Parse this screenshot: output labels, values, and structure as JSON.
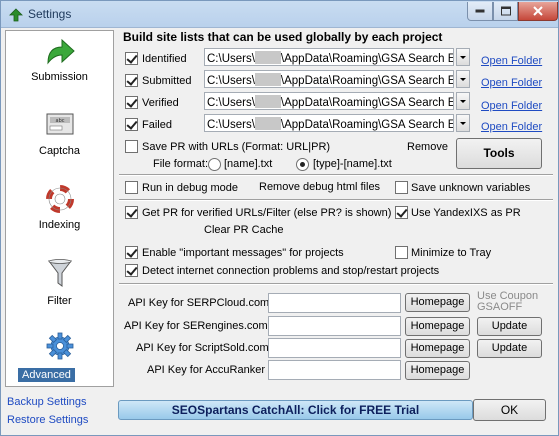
{
  "window": {
    "title": "Settings"
  },
  "sidebar": {
    "items": [
      {
        "label": "Submission",
        "icon": "green-arrow-icon"
      },
      {
        "label": "Captcha",
        "icon": "captcha-icon"
      },
      {
        "label": "Indexing",
        "icon": "lifebuoy-icon"
      },
      {
        "label": "Filter",
        "icon": "funnel-icon"
      },
      {
        "label": "Advanced",
        "icon": "gear-icon",
        "selected": true
      }
    ],
    "backup_label": "Backup Settings",
    "restore_label": "Restore Settings"
  },
  "site_lists": {
    "header": "Build site lists that can be used globally by each project",
    "rows": [
      {
        "label": "Identified",
        "checked": true,
        "path_prefix": "C:\\Users\\",
        "path_suffix": "\\AppData\\Roaming\\GSA Search Er",
        "link": "Open Folder"
      },
      {
        "label": "Submitted",
        "checked": true,
        "path_prefix": "C:\\Users\\",
        "path_suffix": "\\AppData\\Roaming\\GSA Search Er",
        "link": "Open Folder"
      },
      {
        "label": "Verified",
        "checked": true,
        "path_prefix": "C:\\Users\\",
        "path_suffix": "\\AppData\\Roaming\\GSA Search Er",
        "link": "Open Folder"
      },
      {
        "label": "Failed",
        "checked": true,
        "path_prefix": "C:\\Users\\",
        "path_suffix": "\\AppData\\Roaming\\GSA Search Er",
        "link": "Open Folder"
      }
    ],
    "save_pr_label": "Save PR with URLs (Format: URL|PR)",
    "remove_label": "Remove",
    "file_format_label": "File format:",
    "format_option_1": "[name].txt",
    "format_option_2": "[type]-[name].txt",
    "tools_label": "Tools"
  },
  "debug": {
    "run_debug_label": "Run in debug mode",
    "remove_debug_label": "Remove debug html files",
    "save_unknown_label": "Save unknown variables"
  },
  "pr": {
    "get_pr_label": "Get PR for verified URLs/Filter  (else PR? is shown)",
    "use_yandex_label": "Use YandexIXS as PR",
    "clear_pr_label": "Clear PR Cache"
  },
  "messages": {
    "important_label": "Enable \"important messages\" for projects",
    "minimize_label": "Minimize to Tray",
    "detect_label": "Detect internet connection problems and stop/restart projects"
  },
  "api": {
    "serpcloud_label": "API Key for SERPCloud.com",
    "serengines_label": "API Key for SERengines.com",
    "scriptsold_label": "API Key for ScriptSold.com",
    "accuranker_label": "API Key for AccuRanker",
    "homepage_label": "Homepage",
    "update_label": "Update",
    "coupon_line1": "Use Coupon",
    "coupon_line2": "GSAOFF"
  },
  "footer": {
    "catchall_label": "SEOSpartans CatchAll: Click for FREE Trial",
    "ok_label": "OK"
  }
}
